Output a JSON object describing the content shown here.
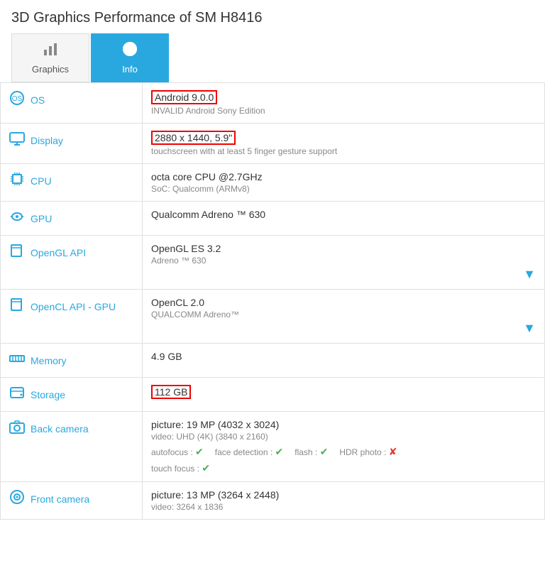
{
  "title": "3D Graphics Performance of SM H8416",
  "tabs": [
    {
      "id": "graphics",
      "label": "Graphics",
      "icon": "📊",
      "active": false
    },
    {
      "id": "info",
      "label": "Info",
      "icon": "ℹ",
      "active": true
    }
  ],
  "rows": [
    {
      "id": "os",
      "icon": "os",
      "label": "OS",
      "value_main": "Android 9.0.0",
      "value_main_highlighted": true,
      "value_sub": "INVALID Android Sony Edition",
      "has_dropdown": false
    },
    {
      "id": "display",
      "icon": "display",
      "label": "Display",
      "value_main": "2880 x 1440, 5.9\"",
      "value_main_highlighted": true,
      "value_sub": "touchscreen with at least 5 finger gesture support",
      "has_dropdown": false
    },
    {
      "id": "cpu",
      "icon": "cpu",
      "label": "CPU",
      "value_main": "octa core CPU @2.7GHz",
      "value_main_highlighted": false,
      "value_sub": "SoC: Qualcomm (ARMv8)",
      "has_dropdown": false
    },
    {
      "id": "gpu",
      "icon": "gpu",
      "label": "GPU",
      "value_main": "Qualcomm Adreno ™ 630",
      "value_main_highlighted": false,
      "value_sub": "",
      "has_dropdown": false
    },
    {
      "id": "opengl",
      "icon": "opengl",
      "label": "OpenGL API",
      "value_main": "OpenGL ES 3.2",
      "value_main_highlighted": false,
      "value_sub": "Adreno ™ 630",
      "has_dropdown": true
    },
    {
      "id": "opencl",
      "icon": "opencl",
      "label": "OpenCL API - GPU",
      "value_main": "OpenCL 2.0",
      "value_main_highlighted": false,
      "value_sub": "QUALCOMM Adreno™",
      "has_dropdown": true
    },
    {
      "id": "memory",
      "icon": "memory",
      "label": "Memory",
      "value_main": "4.9 GB",
      "value_main_highlighted": false,
      "value_sub": "",
      "has_dropdown": false
    },
    {
      "id": "storage",
      "icon": "storage",
      "label": "Storage",
      "value_main": "112 GB",
      "value_main_highlighted": true,
      "value_sub": "",
      "has_dropdown": false
    },
    {
      "id": "back_camera",
      "icon": "camera",
      "label": "Back camera",
      "value_main": "picture: 19 MP (4032 x 3024)",
      "value_main_highlighted": false,
      "value_sub": "video: UHD (4K) (3840 x 2160)",
      "has_dropdown": false,
      "camera_features": [
        {
          "label": "autofocus",
          "value": true
        },
        {
          "label": "face detection",
          "value": true
        },
        {
          "label": "flash",
          "value": true
        },
        {
          "label": "HDR photo",
          "value": false
        }
      ],
      "camera_features2": [
        {
          "label": "touch focus",
          "value": true
        }
      ]
    },
    {
      "id": "front_camera",
      "icon": "front_camera",
      "label": "Front camera",
      "value_main": "picture: 13 MP (3264 x 2448)",
      "value_main_highlighted": false,
      "value_sub": "video: 3264 x 1836",
      "has_dropdown": false
    }
  ]
}
